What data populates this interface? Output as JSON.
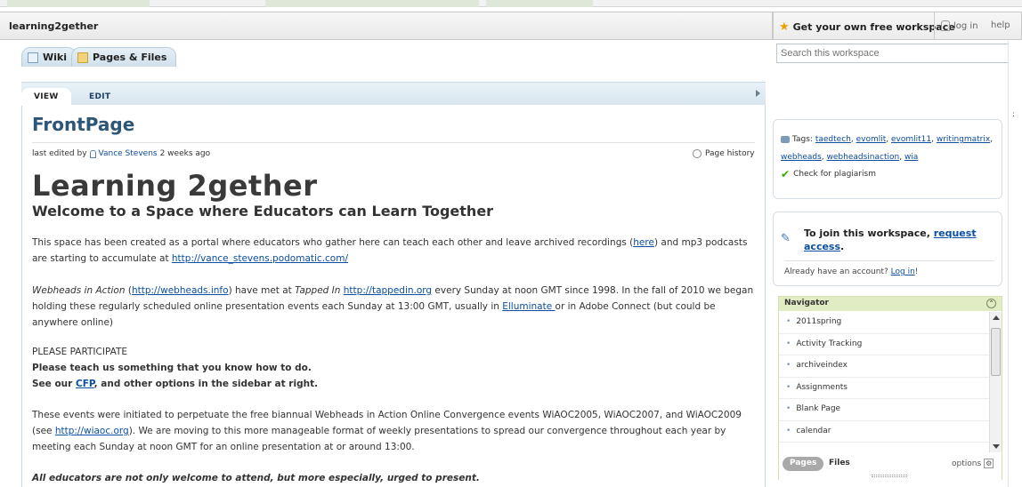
{
  "workspace": {
    "name": "learning2gether"
  },
  "topbar": {
    "get_free": "Get your own free workspace",
    "login": "log in",
    "help": "help"
  },
  "tabs": [
    {
      "label": "Wiki",
      "icon": "wiki-icon"
    },
    {
      "label": "Pages & Files",
      "icon": "folder-icon"
    }
  ],
  "search": {
    "placeholder": "Search this workspace"
  },
  "view_tabs": {
    "view": "VIEW",
    "edit": "EDIT"
  },
  "page": {
    "title": "FrontPage",
    "edited_prefix": "last edited by",
    "edited_user": "Vance Stevens",
    "edited_when": "2 weeks ago",
    "history": "Page history",
    "heading": "Learning 2gether",
    "subheading": "Welcome to a Space where Educators can Learn Together",
    "p1_a": "This space has been created as a portal where educators who gather here can teach each other and leave archived recordings (",
    "p1_link1": "here",
    "p1_b": ") and mp3 podcasts are starting to accumulate at ",
    "p1_link2": "http://vance_stevens.podomatic.com/",
    "p2_ital": "Webheads in Action",
    "p2_a": " (",
    "p2_link1": "http://webheads.info",
    "p2_b": ") have met at ",
    "p2_ital2": "Tapped In",
    "p2_c": " ",
    "p2_link2": "http://tappedin.org",
    "p2_d": " every Sunday at noon GMT since 1998. In the fall of 2010 we began holding these regularly scheduled online presentation events each Sunday at 13:00 GMT, usually in ",
    "p2_link3": "Elluminate ",
    "p2_e": "or in Adobe Connect (but could be anywhere online)",
    "p3_line1": "PLEASE PARTICIPATE",
    "p3_line2": "Please teach us something that you know how to do.",
    "p3_line3_a": "See our ",
    "p3_line3_link": "CFP",
    "p3_line3_b": ", and other options in the sidebar at right.",
    "p4_a": "These events were initiated to perpetuate the free biannual Webheads in Action Online Convergence events  WiAOC2005, WiAOC2007, and WiAOC2009 (see ",
    "p4_link": "http://wiaoc.org",
    "p4_b": ").  We are moving to this more manageable format of weekly presentations to spread our convergence throughout each year by meeting each Sunday at noon GMT for an online presentation at or around 13:00.",
    "p5": "All educators are not only welcome to attend, but more especially, urged to present."
  },
  "sidebar": {
    "tags_label": "Tags:",
    "tags": [
      "taedtech",
      "evomlit",
      "evomlit11",
      "writingmatrix",
      "webheads",
      "webheadsinaction",
      "wia"
    ],
    "plagiarism": "Check for plagiarism",
    "join_a": "To join this workspace, ",
    "join_link": "request access",
    "join_b": ".",
    "already_a": "Already have an account? ",
    "already_link": "Log in",
    "already_b": "!",
    "navigator": {
      "title": "Navigator",
      "items": [
        "2011spring",
        "Activity Tracking",
        "archiveindex",
        "Assignments",
        "Blank Page",
        "calendar"
      ],
      "pages_label": "Pages",
      "files_label": "Files",
      "options_label": "options"
    }
  }
}
